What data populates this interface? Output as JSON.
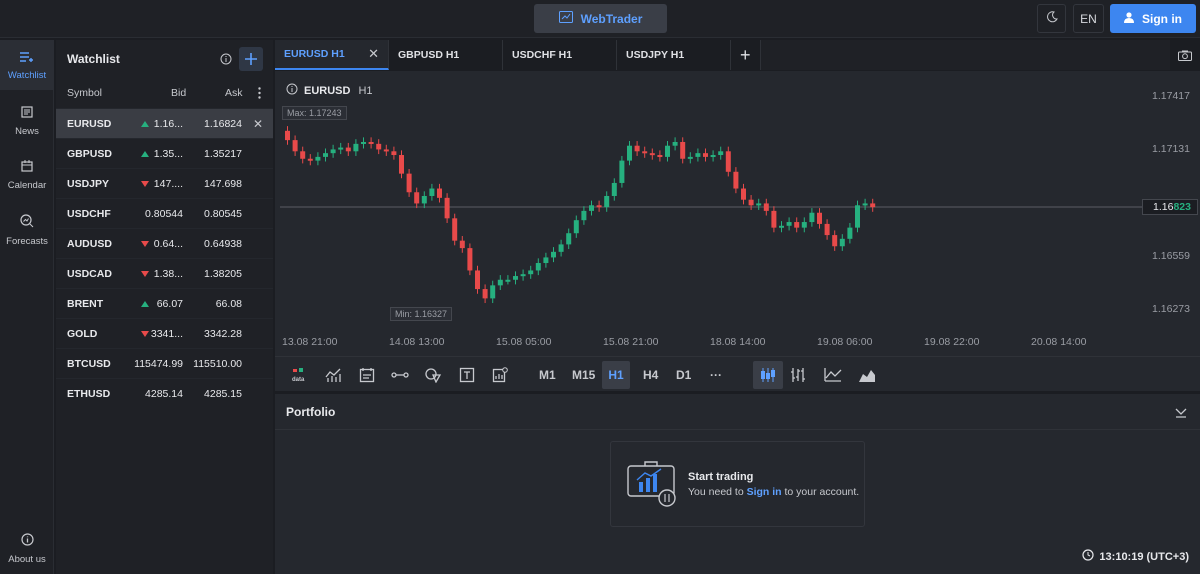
{
  "topbar": {
    "brand": "WebTrader",
    "language": "EN",
    "signin": "Sign in"
  },
  "nav": [
    {
      "label": "Watchlist",
      "icon": "watchlist-icon"
    },
    {
      "label": "News",
      "icon": "news-icon"
    },
    {
      "label": "Calendar",
      "icon": "calendar-icon"
    },
    {
      "label": "Forecasts",
      "icon": "forecasts-icon"
    },
    {
      "label": "About us",
      "icon": "info-icon"
    }
  ],
  "watchlist": {
    "title": "Watchlist",
    "col_symbol": "Symbol",
    "col_bid": "Bid",
    "col_ask": "Ask",
    "rows": [
      {
        "symbol": "EURUSD",
        "dir": "up",
        "bid": "1.16...",
        "ask": "1.16824"
      },
      {
        "symbol": "GBPUSD",
        "dir": "up",
        "bid": "1.35...",
        "ask": "1.35217"
      },
      {
        "symbol": "USDJPY",
        "dir": "down",
        "bid": "147....",
        "ask": "147.698"
      },
      {
        "symbol": "USDCHF",
        "dir": "",
        "bid": "0.80544",
        "ask": "0.80545"
      },
      {
        "symbol": "AUDUSD",
        "dir": "down",
        "bid": "0.64...",
        "ask": "0.64938"
      },
      {
        "symbol": "USDCAD",
        "dir": "down",
        "bid": "1.38...",
        "ask": "1.38205"
      },
      {
        "symbol": "BRENT",
        "dir": "up",
        "bid": "66.07",
        "ask": "66.08"
      },
      {
        "symbol": "GOLD",
        "dir": "down",
        "bid": "3341...",
        "ask": "3342.28"
      },
      {
        "symbol": "BTCUSD",
        "dir": "",
        "bid": "115474.99",
        "ask": "115510.00"
      },
      {
        "symbol": "ETHUSD",
        "dir": "",
        "bid": "4285.14",
        "ask": "4285.15"
      }
    ]
  },
  "tabs": [
    "EURUSD H1",
    "GBPUSD H1",
    "USDCHF H1",
    "USDJPY H1"
  ],
  "chart": {
    "symbol": "EURUSD",
    "tf": "H1",
    "max_label": "Max: 1.17243",
    "min_label": "Min: 1.16327",
    "price_ticks": [
      "1.17417",
      "1.17131",
      "1.16559",
      "1.16273"
    ],
    "current_price_main": "1.16",
    "current_price_tail": "823",
    "time_ticks": [
      "13.08 21:00",
      "14.08 13:00",
      "15.08 05:00",
      "15.08 21:00",
      "18.08 14:00",
      "19.08 06:00",
      "19.08 22:00",
      "20.08 14:00"
    ],
    "up_color": "#26b07f",
    "down_color": "#e84a4a"
  },
  "chart_data": {
    "type": "candlestick",
    "ylim": [
      1.162,
      1.175
    ],
    "closes": [
      1.1718,
      1.1712,
      1.1708,
      1.1707,
      1.1709,
      1.1711,
      1.1713,
      1.1714,
      1.1712,
      1.1716,
      1.1717,
      1.1716,
      1.1713,
      1.1712,
      1.171,
      1.17,
      1.169,
      1.1684,
      1.1688,
      1.1692,
      1.1687,
      1.1676,
      1.1664,
      1.166,
      1.1648,
      1.1638,
      1.1633,
      1.164,
      1.1643,
      1.1643,
      1.1645,
      1.1646,
      1.1648,
      1.1652,
      1.1655,
      1.1658,
      1.1662,
      1.1668,
      1.1675,
      1.168,
      1.1683,
      1.1682,
      1.1688,
      1.1695,
      1.1707,
      1.1715,
      1.1712,
      1.1711,
      1.171,
      1.1709,
      1.1715,
      1.1717,
      1.1708,
      1.1709,
      1.1711,
      1.1709,
      1.171,
      1.1712,
      1.1701,
      1.1692,
      1.1686,
      1.1683,
      1.1684,
      1.168,
      1.1671,
      1.1672,
      1.1674,
      1.1671,
      1.1674,
      1.1679,
      1.1673,
      1.1667,
      1.1661,
      1.1665,
      1.1671,
      1.1683,
      1.1684,
      1.1682
    ],
    "opens": [
      1.1723,
      1.1718,
      1.1712,
      1.1708,
      1.1707,
      1.1709,
      1.1711,
      1.1713,
      1.1714,
      1.1712,
      1.1716,
      1.1717,
      1.1716,
      1.1713,
      1.1712,
      1.171,
      1.17,
      1.169,
      1.1684,
      1.1688,
      1.1692,
      1.1687,
      1.1676,
      1.1664,
      1.166,
      1.1648,
      1.1638,
      1.1633,
      1.164,
      1.1643,
      1.1643,
      1.1645,
      1.1646,
      1.1648,
      1.1652,
      1.1655,
      1.1658,
      1.1662,
      1.1668,
      1.1675,
      1.168,
      1.1683,
      1.1682,
      1.1688,
      1.1695,
      1.1707,
      1.1715,
      1.1712,
      1.1711,
      1.171,
      1.1709,
      1.1715,
      1.1717,
      1.1708,
      1.1709,
      1.1711,
      1.1709,
      1.171,
      1.1712,
      1.1701,
      1.1692,
      1.1686,
      1.1683,
      1.1684,
      1.168,
      1.1671,
      1.1672,
      1.1674,
      1.1671,
      1.1674,
      1.1679,
      1.1673,
      1.1667,
      1.1661,
      1.1665,
      1.1671,
      1.1683,
      1.1684
    ]
  },
  "timeframes": [
    "M1",
    "M15",
    "H1",
    "H4",
    "D1",
    "···"
  ],
  "portfolio": {
    "title": "Portfolio",
    "start_title": "Start trading",
    "msg_before": "You need to ",
    "msg_link": "Sign in",
    "msg_after": " to your account."
  },
  "clock": "13:10:19 (UTC+3)"
}
